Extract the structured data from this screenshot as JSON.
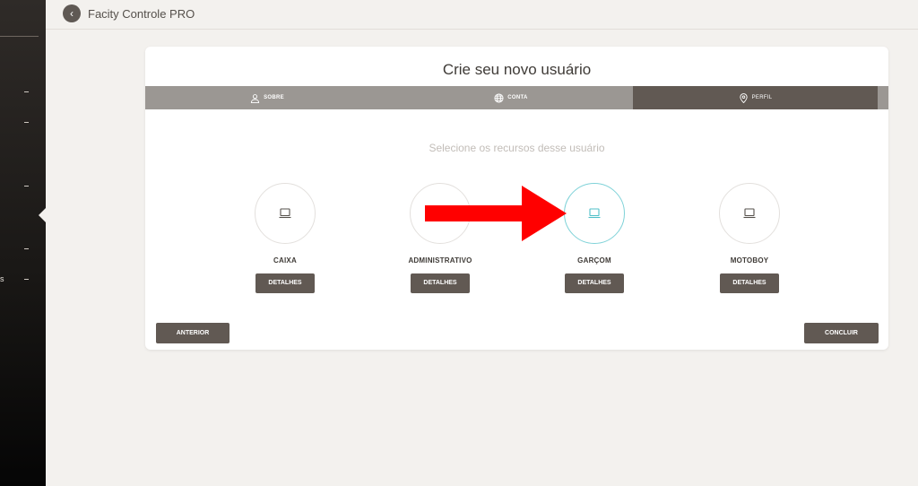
{
  "header": {
    "title": "Facity Controle PRO",
    "back_icon": "chevron-left-icon"
  },
  "sidebar": {
    "visible_fragment": "s"
  },
  "wizard": {
    "title": "Crie seu novo usuário",
    "steps": [
      {
        "label": "SOBRE",
        "icon": "user-icon"
      },
      {
        "label": "CONTA",
        "icon": "globe-icon"
      },
      {
        "label": "PERFIL",
        "icon": "map-pin-icon",
        "active": true
      }
    ],
    "subtitle": "Selecione os recursos desse usuário",
    "resources": [
      {
        "label": "CAIXA",
        "details": "DETALHES",
        "icon": "laptop-icon"
      },
      {
        "label": "ADMINISTRATIVO",
        "details": "DETALHES",
        "icon": "laptop-icon"
      },
      {
        "label": "GARÇOM",
        "details": "DETALHES",
        "icon": "laptop-icon",
        "selected": true
      },
      {
        "label": "MOTOBOY",
        "details": "DETALHES",
        "icon": "laptop-icon"
      }
    ],
    "prev_label": "ANTERIOR",
    "next_label": "CONCLUIR"
  },
  "colors": {
    "accent": "#615953",
    "selected_border": "#7fd2d8",
    "arrow": "#ff0000"
  }
}
